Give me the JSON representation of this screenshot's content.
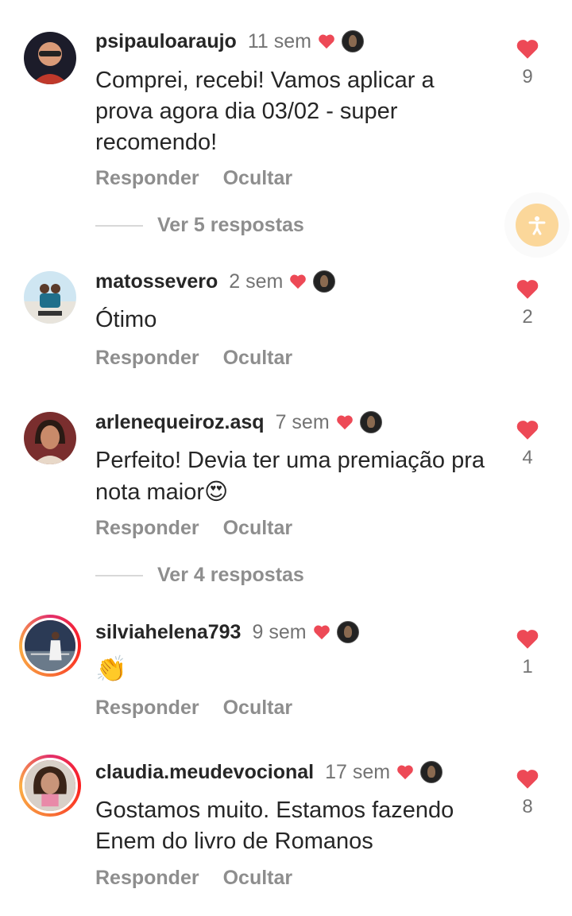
{
  "comments": [
    {
      "username": "psipauloaraujo",
      "time": "11 sem",
      "text": "Comprei, recebi! Vamos aplicar a prova agora dia 03/02 - super recomendo!",
      "likes": "9",
      "reply": "Responder",
      "hide": "Ocultar",
      "view_replies": "Ver 5 respostas"
    },
    {
      "username": "matossevero",
      "time": "2 sem",
      "text": "Ótimo",
      "likes": "2",
      "reply": "Responder",
      "hide": "Ocultar"
    },
    {
      "username": "arlenequeiroz.asq",
      "time": "7 sem",
      "text": "Perfeito! Devia ter uma premiação pra nota maior",
      "emoji": "😍",
      "likes": "4",
      "reply": "Responder",
      "hide": "Ocultar",
      "view_replies": "Ver 4 respostas"
    },
    {
      "username": "silviahelena793",
      "time": "9 sem",
      "text": "👏",
      "likes": "1",
      "reply": "Responder",
      "hide": "Ocultar"
    },
    {
      "username": "claudia.meudevocional",
      "time": "17 sem",
      "text": "Gostamos muito. Estamos fazendo Enem do livro de Romanos",
      "likes": "8",
      "reply": "Responder",
      "hide": "Ocultar"
    }
  ],
  "colors": {
    "heart": "#ed4956",
    "muted": "#8e8e8e",
    "accessibility": "#fbd79a"
  },
  "icons": {
    "like": "heart-icon",
    "creator_liked": "heart-icon",
    "creator_avatar": "creator-avatar-icon",
    "accessibility": "accessibility-icon"
  }
}
